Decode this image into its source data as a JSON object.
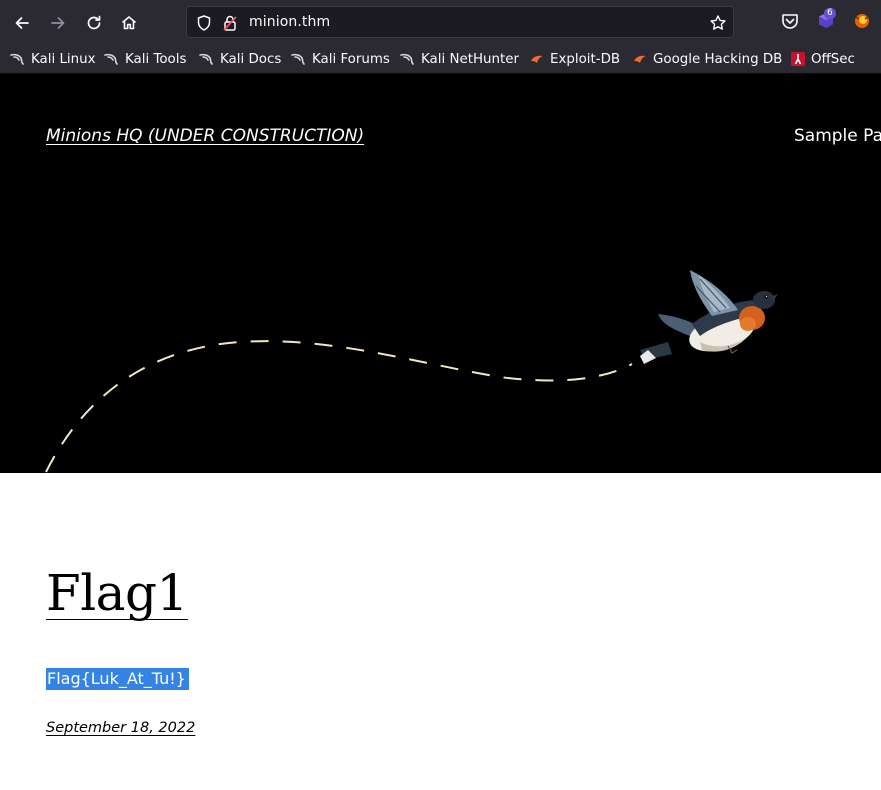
{
  "browser": {
    "url": "minion.thm",
    "extension_badge": "6",
    "bookmarks": [
      {
        "label": "Kali Linux",
        "icon": "kali-dragon-icon"
      },
      {
        "label": "Kali Tools",
        "icon": "kali-dragon-icon"
      },
      {
        "label": "Kali Docs",
        "icon": "kali-dragon-icon"
      },
      {
        "label": "Kali Forums",
        "icon": "kali-dragon-icon"
      },
      {
        "label": "Kali NetHunter",
        "icon": "kali-dragon-icon"
      },
      {
        "label": "Exploit-DB",
        "icon": "exploit-db-icon"
      },
      {
        "label": "Google Hacking DB",
        "icon": "exploit-db-icon"
      },
      {
        "label": "OffSec",
        "icon": "offsec-icon"
      }
    ]
  },
  "site": {
    "title": "Minions HQ (UNDER CONSTRUCTION)",
    "nav_item": "Sample Page"
  },
  "post": {
    "title": "Flag1",
    "content": "Flag{Luk_At_Tu!}",
    "date": "September 18, 2022"
  },
  "colors": {
    "chrome": "#2b2a33",
    "urlbar": "#1c1b22",
    "hero": "#000000",
    "selection": "#3584e4"
  }
}
